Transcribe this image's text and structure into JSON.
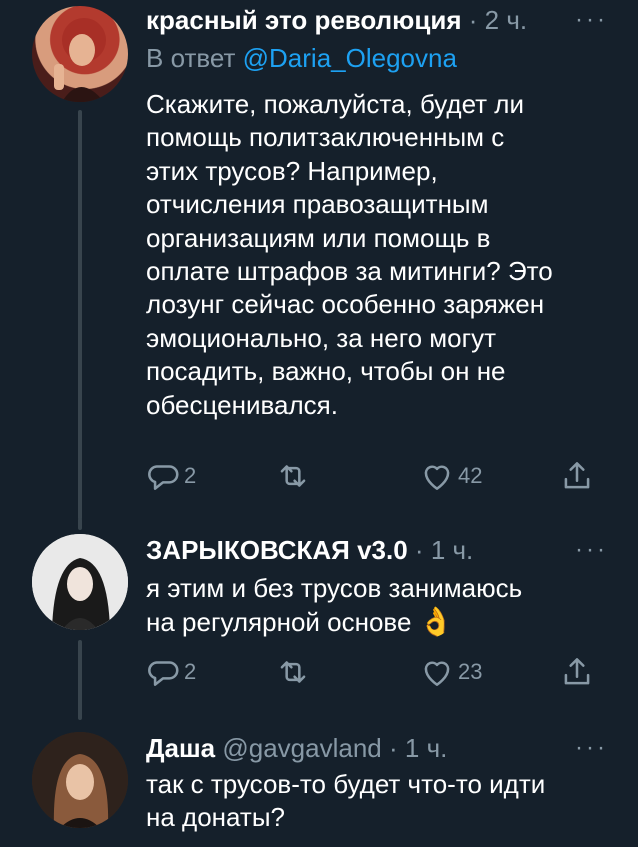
{
  "tweets": [
    {
      "name": "красный это революция",
      "handle": "",
      "dot": "·",
      "time": "2 ч.",
      "more": "···",
      "reply_prefix": "В ответ",
      "reply_mention": "@Daria_Olegovna",
      "text": "Скажите, пожалуйста, будет ли\nпомощь политзаключенным с\nэтих трусов? Например,\nотчисления правозащитным\nорганизациям или помощь в\nоплате штрафов за митинги? Это\nлозунг сейчас особенно заряжен\nэмоционально, за него могут\nпосадить, важно, чтобы он не\nобесценивался.",
      "replies": "2",
      "retweets": "",
      "likes": "42",
      "avatar_color": "#b5483c"
    },
    {
      "name": "ЗАРЫКОВСКАЯ v3.0",
      "handle": "",
      "dot": "·",
      "time": "1 ч.",
      "more": "···",
      "text": "я этим и без трусов занимаюсь\nна регулярной основе",
      "emoji": "👌",
      "replies": "2",
      "retweets": "",
      "likes": "23",
      "avatar_color": "#d9d9d9"
    },
    {
      "name": "Даша",
      "handle": "@gavgavland",
      "dot": "·",
      "time": "1 ч.",
      "more": "···",
      "text": "так с трусов-то будет что-то идти\nна донаты?",
      "avatar_color": "#6b4a3a"
    }
  ]
}
